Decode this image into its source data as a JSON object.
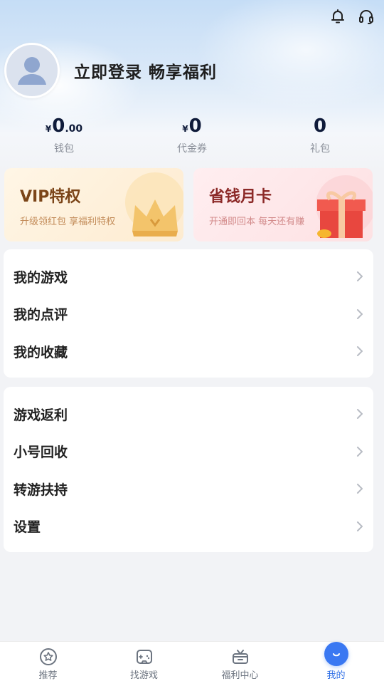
{
  "user": {
    "login_prompt": "立即登录 畅享福利"
  },
  "stats": [
    {
      "currency": "¥",
      "value_int": "0",
      "value_dec": ".00",
      "label": "钱包"
    },
    {
      "currency": "¥",
      "value_int": "0",
      "value_dec": "",
      "label": "代金券"
    },
    {
      "currency": "",
      "value_int": "0",
      "value_dec": "",
      "label": "礼包"
    }
  ],
  "promos": {
    "vip": {
      "title": "VIP特权",
      "subtitle": "升级领红包 享福利特权"
    },
    "month_card": {
      "title": "省钱月卡",
      "subtitle": "开通即回本 每天还有赚"
    }
  },
  "menu_group_1": [
    {
      "label": "我的游戏"
    },
    {
      "label": "我的点评"
    },
    {
      "label": "我的收藏"
    }
  ],
  "menu_group_2": [
    {
      "label": "游戏返利"
    },
    {
      "label": "小号回收"
    },
    {
      "label": "转游扶持"
    },
    {
      "label": "设置"
    }
  ],
  "tabbar": {
    "items": [
      {
        "label": "推荐",
        "icon": "star-icon"
      },
      {
        "label": "找游戏",
        "icon": "gamepad-icon"
      },
      {
        "label": "福利中心",
        "icon": "gift-box-icon"
      },
      {
        "label": "我的",
        "icon": "profile-smile-icon"
      }
    ],
    "active_index": 3
  },
  "colors": {
    "accent": "#3a78f2",
    "vip_title": "#7b4518",
    "month_title": "#8c2a28"
  }
}
